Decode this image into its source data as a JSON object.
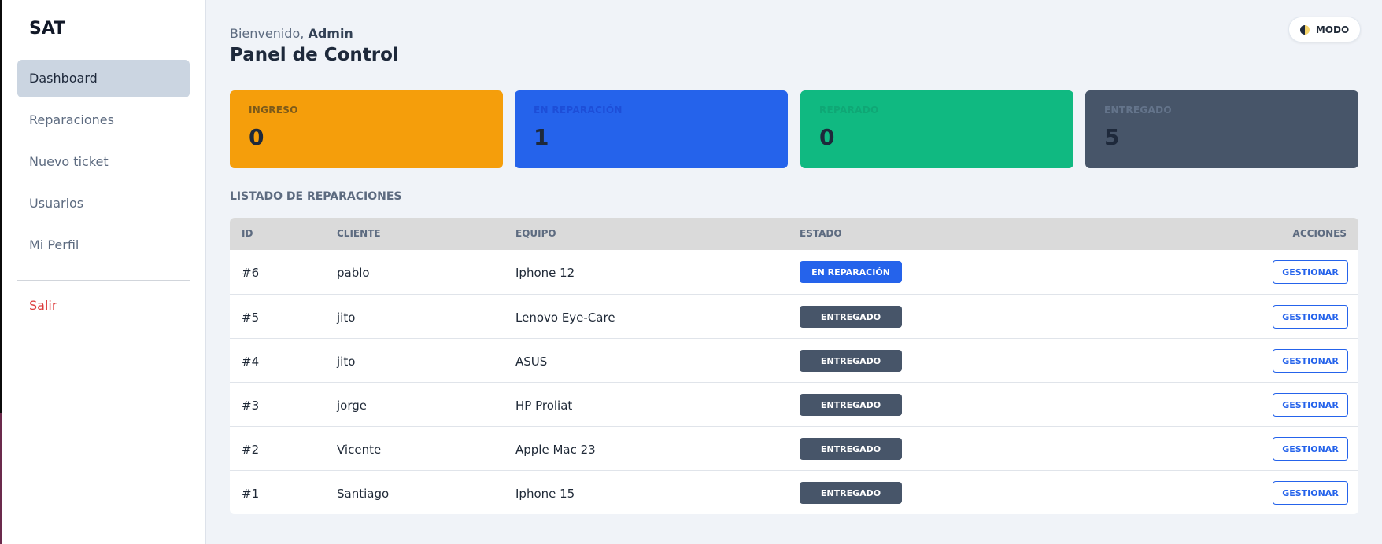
{
  "brand": "SAT",
  "nav": {
    "items": [
      {
        "label": "Dashboard",
        "active": true
      },
      {
        "label": "Reparaciones",
        "active": false
      },
      {
        "label": "Nuevo ticket",
        "active": false
      },
      {
        "label": "Usuarios",
        "active": false
      },
      {
        "label": "Mi Perfil",
        "active": false
      }
    ],
    "logout": "Salir"
  },
  "header": {
    "welcome_prefix": "Bienvenido,",
    "welcome_user": "Admin",
    "title": "Panel de Control",
    "mode_button": "MODO",
    "mode_icon": "half-moon-icon"
  },
  "stats": [
    {
      "label": "INGRESO",
      "value": "0",
      "bg": "#f59e0b",
      "label_color": "#7c5a1a"
    },
    {
      "label": "EN REPARACIÓN",
      "value": "1",
      "bg": "#2563eb",
      "label_color": "#1d4ed8"
    },
    {
      "label": "REPARADO",
      "value": "0",
      "bg": "#10b981",
      "label_color": "#0fa775"
    },
    {
      "label": "ENTREGADO",
      "value": "5",
      "bg": "#475569",
      "label_color": "#64748b"
    }
  ],
  "table": {
    "title": "LISTADO DE REPARACIONES",
    "headers": {
      "id": "ID",
      "client": "CLIENTE",
      "device": "EQUIPO",
      "status": "ESTADO",
      "actions": "ACCIONES"
    },
    "action_label": "GESTIONAR",
    "status_colors": {
      "EN REPARACIÓN": "#2563eb",
      "ENTREGADO": "#475569"
    },
    "rows": [
      {
        "id": "#6",
        "client": "pablo",
        "device": "Iphone 12",
        "status": "EN REPARACIÓN"
      },
      {
        "id": "#5",
        "client": "jito",
        "device": "Lenovo Eye-Care",
        "status": "ENTREGADO"
      },
      {
        "id": "#4",
        "client": "jito",
        "device": "ASUS",
        "status": "ENTREGADO"
      },
      {
        "id": "#3",
        "client": "jorge",
        "device": "HP Proliat",
        "status": "ENTREGADO"
      },
      {
        "id": "#2",
        "client": "Vicente",
        "device": "Apple Mac 23",
        "status": "ENTREGADO"
      },
      {
        "id": "#1",
        "client": "Santiago",
        "device": "Iphone 15",
        "status": "ENTREGADO"
      }
    ]
  }
}
